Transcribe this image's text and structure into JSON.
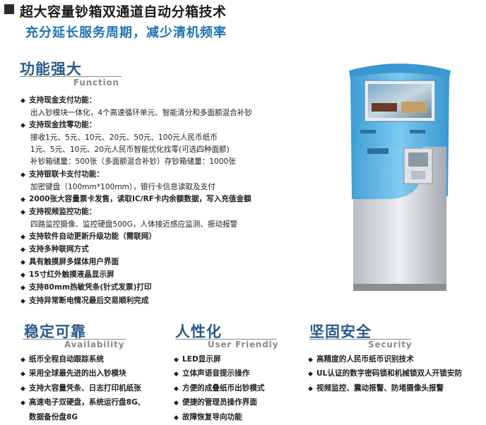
{
  "header": {
    "title": "超大容量钞箱双通道自动分箱技术",
    "subtitle": "充分延长服务周期，减少清机频率"
  },
  "function": {
    "title_cn": "功能强大",
    "title_en": "Function",
    "items": [
      {
        "text": "支持现金支付功能：",
        "bullet": true
      },
      {
        "text": "出入钞模块一体化，4个高速循环单元、智能清分和多面额混合补钞",
        "bullet": false
      },
      {
        "text": "支持现金找零功能：",
        "bullet": true
      },
      {
        "text": "接收1元、5元、10元、20元、50元、100元人民币纸币",
        "bullet": false
      },
      {
        "text": "1元、5元、10元、20元人民币智能优化找零(可选四种面额)",
        "bullet": false
      },
      {
        "text": "补钞箱储量：500张（多面额混合补钞）存钞箱储量：1000张",
        "bullet": false
      },
      {
        "text": "支持银联卡支付功能：",
        "bullet": true
      },
      {
        "text": "加密键盘（100mm*100mm），银行卡信息读取及支付",
        "bullet": false
      },
      {
        "text": "2000张大容量票卡发售，读取IC/RF卡内余额数据，写入充值金额",
        "bullet": true
      },
      {
        "text": "支持视频监控功能：",
        "bullet": true
      },
      {
        "text": "四路监控摄像、监控硬盘500G，人体接近感应监测、振动报警",
        "bullet": false
      },
      {
        "text": "支持软件自动更新升级功能（需联网）",
        "bullet": true
      },
      {
        "text": "支持多种联网方式",
        "bullet": true
      },
      {
        "text": "具有触摸屏多媒体用户界面",
        "bullet": true
      },
      {
        "text": "15寸红外触摸液晶显示屏",
        "bullet": true
      },
      {
        "text": "支持80mm热敏凭条(针式发票)打印",
        "bullet": true
      },
      {
        "text": "支持异常断电情况最后交易顺利完成",
        "bullet": true
      }
    ]
  },
  "availability": {
    "title_cn": "稳定可靠",
    "title_en": "Availability",
    "items": [
      {
        "text": "纸币全程自动跟踪系统",
        "bullet": true
      },
      {
        "text": "采用全球最先进的出入钞模块",
        "bullet": true
      },
      {
        "text": "支持大容量凭条、日志打印机纸张",
        "bullet": true
      },
      {
        "text": "高速电子双硬盘，系统运行盘8G、",
        "bullet": true
      },
      {
        "text": "数据备份盘8G",
        "bullet": false
      }
    ]
  },
  "user_friendly": {
    "title_cn": "人性化",
    "title_en": "User Friendly",
    "items": [
      {
        "text": "LED显示屏",
        "bullet": true
      },
      {
        "text": "立体声语音提示操作",
        "bullet": true
      },
      {
        "text": "方便的成叠纸币出钞模式",
        "bullet": true
      },
      {
        "text": "便捷的管理员操作界面",
        "bullet": true
      },
      {
        "text": "故障恢复导向功能",
        "bullet": true
      }
    ]
  },
  "security": {
    "title_cn": "坚固安全",
    "title_en": "Security",
    "items": [
      {
        "text": "高精度的人民币纸币识别技术",
        "bullet": true
      },
      {
        "text": "UL认证的数字密码锁和机械锁双人开锁安防",
        "bullet": true
      },
      {
        "text": "视频监控、震动报警、防堵摄像头报警",
        "bullet": true
      }
    ]
  },
  "bullet_glyph": "◆",
  "colors": {
    "section_title": "#2a5b8c",
    "subtitle": "#1e74b4",
    "kiosk_blue": "#5cb6e6",
    "kiosk_silver": "#d4d7dc"
  }
}
